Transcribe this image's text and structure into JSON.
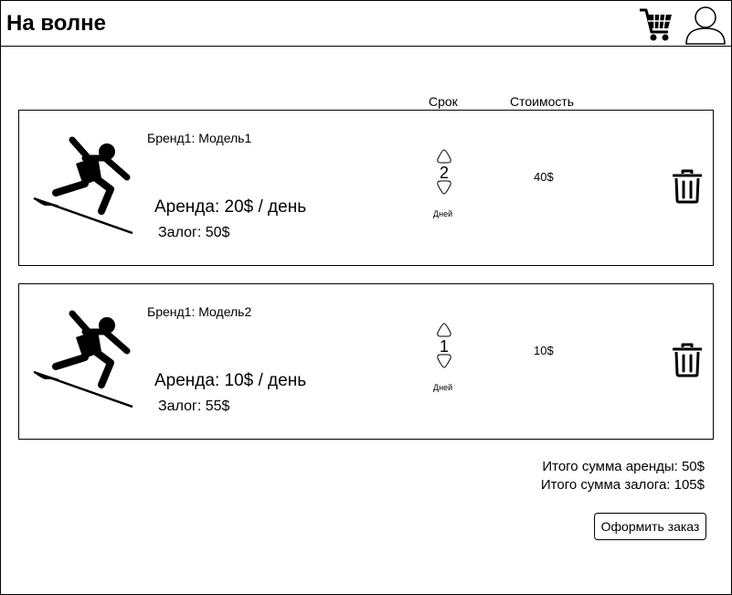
{
  "header": {
    "title": "На волне",
    "cart_icon": "shopping-cart-icon",
    "user_icon": "user-profile-icon"
  },
  "columns": {
    "term": "Срок",
    "cost": "Стоимость"
  },
  "cart_items": [
    {
      "name": "Бренд1: Модель1",
      "rent": "Аренда: 20$ / день",
      "deposit": "Залог: 50$",
      "quantity": "2",
      "unit": "Дней",
      "cost": "40$",
      "image_icon": "surfer-icon",
      "delete_icon": "trash-icon"
    },
    {
      "name": "Бренд1: Модель2",
      "rent": "Аренда: 10$ / день",
      "deposit": "Залог: 55$",
      "quantity": "1",
      "unit": "Дней",
      "cost": "10$",
      "image_icon": "surfer-icon",
      "delete_icon": "trash-icon"
    }
  ],
  "totals": {
    "rent": "Итого сумма аренды: 50$",
    "deposit": "Итого сумма залога: 105$"
  },
  "order_button": "Оформить заказ"
}
